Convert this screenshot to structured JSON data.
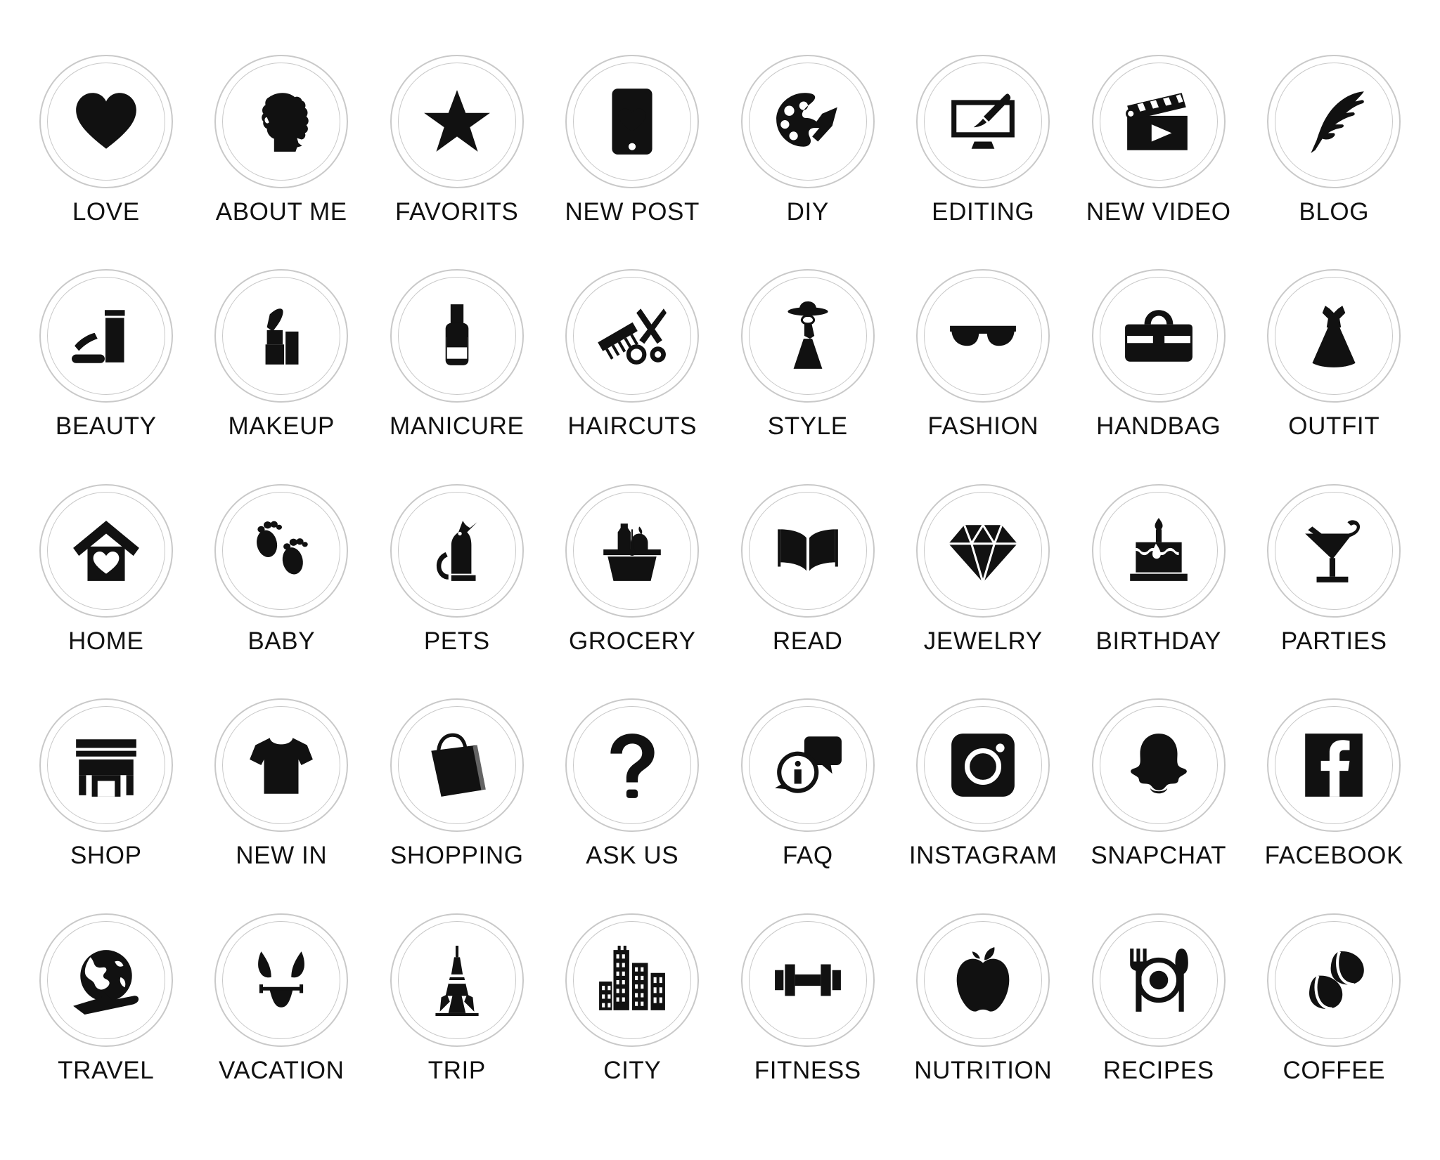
{
  "page": {
    "title": "Instagram Story Highlight Cover Icon Set",
    "background_color": "#ffffff",
    "icon_color": "#111111",
    "ring_color": "#c9c9c9",
    "columns": 8,
    "rows": 5,
    "total_icons": 40
  },
  "icons": [
    {
      "label": "LOVE",
      "icon": "heart-icon",
      "row": 1,
      "col": 1
    },
    {
      "label": "ABOUT ME",
      "icon": "woman-head-silhouette-icon",
      "row": 1,
      "col": 2
    },
    {
      "label": "FAVORITS",
      "icon": "star-icon",
      "row": 1,
      "col": 3
    },
    {
      "label": "NEW POST",
      "icon": "phone-heart-icon",
      "row": 1,
      "col": 4
    },
    {
      "label": "DIY",
      "icon": "paint-palette-icon",
      "row": 1,
      "col": 5
    },
    {
      "label": "EDITING",
      "icon": "monitor-brush-icon",
      "row": 1,
      "col": 6
    },
    {
      "label": "NEW VIDEO",
      "icon": "clapperboard-icon",
      "row": 1,
      "col": 7
    },
    {
      "label": "BLOG",
      "icon": "feather-quill-icon",
      "row": 1,
      "col": 8
    },
    {
      "label": "BEAUTY",
      "icon": "cosmetics-tube-icon",
      "row": 2,
      "col": 1
    },
    {
      "label": "MAKEUP",
      "icon": "lipstick-icon",
      "row": 2,
      "col": 2
    },
    {
      "label": "MANICURE",
      "icon": "nail-polish-icon",
      "row": 2,
      "col": 3
    },
    {
      "label": "HAIRCUTS",
      "icon": "comb-scissors-icon",
      "row": 2,
      "col": 4
    },
    {
      "label": "STYLE",
      "icon": "woman-hat-dress-icon",
      "row": 2,
      "col": 5
    },
    {
      "label": "FASHION",
      "icon": "sunglasses-icon",
      "row": 2,
      "col": 6
    },
    {
      "label": "HANDBAG",
      "icon": "handbag-icon",
      "row": 2,
      "col": 7
    },
    {
      "label": "OUTFIT",
      "icon": "dress-icon",
      "row": 2,
      "col": 8
    },
    {
      "label": "HOME",
      "icon": "house-heart-icon",
      "row": 3,
      "col": 1
    },
    {
      "label": "BABY",
      "icon": "baby-footprints-icon",
      "row": 3,
      "col": 2
    },
    {
      "label": "PETS",
      "icon": "cat-icon",
      "row": 3,
      "col": 3
    },
    {
      "label": "GROCERY",
      "icon": "grocery-basket-icon",
      "row": 3,
      "col": 4
    },
    {
      "label": "READ",
      "icon": "open-book-icon",
      "row": 3,
      "col": 5
    },
    {
      "label": "JEWELRY",
      "icon": "diamond-icon",
      "row": 3,
      "col": 6
    },
    {
      "label": "BIRTHDAY",
      "icon": "birthday-cake-icon",
      "row": 3,
      "col": 7
    },
    {
      "label": "PARTIES",
      "icon": "cocktail-glass-icon",
      "row": 3,
      "col": 8
    },
    {
      "label": "SHOP",
      "icon": "storefront-icon",
      "row": 4,
      "col": 1
    },
    {
      "label": "NEW IN",
      "icon": "tshirt-icon",
      "row": 4,
      "col": 2
    },
    {
      "label": "SHOPPING",
      "icon": "shopping-bag-icon",
      "row": 4,
      "col": 3
    },
    {
      "label": "ASK US",
      "icon": "question-mark-icon",
      "row": 4,
      "col": 4
    },
    {
      "label": "FAQ",
      "icon": "info-speech-bubble-icon",
      "row": 4,
      "col": 5
    },
    {
      "label": "INSTAGRAM",
      "icon": "instagram-icon",
      "row": 4,
      "col": 6
    },
    {
      "label": "SNAPCHAT",
      "icon": "snapchat-ghost-icon",
      "row": 4,
      "col": 7
    },
    {
      "label": "FACEBOOK",
      "icon": "facebook-icon",
      "row": 4,
      "col": 8
    },
    {
      "label": "TRAVEL",
      "icon": "globe-plane-icon",
      "row": 5,
      "col": 1
    },
    {
      "label": "VACATION",
      "icon": "bikini-icon",
      "row": 5,
      "col": 2
    },
    {
      "label": "TRIP",
      "icon": "eiffel-tower-icon",
      "row": 5,
      "col": 3
    },
    {
      "label": "CITY",
      "icon": "city-buildings-icon",
      "row": 5,
      "col": 4
    },
    {
      "label": "FITNESS",
      "icon": "dumbbell-icon",
      "row": 5,
      "col": 5
    },
    {
      "label": "NUTRITION",
      "icon": "apple-icon",
      "row": 5,
      "col": 6
    },
    {
      "label": "RECIPES",
      "icon": "plate-cutlery-icon",
      "row": 5,
      "col": 7
    },
    {
      "label": "COFFEE",
      "icon": "coffee-beans-icon",
      "row": 5,
      "col": 8
    }
  ]
}
